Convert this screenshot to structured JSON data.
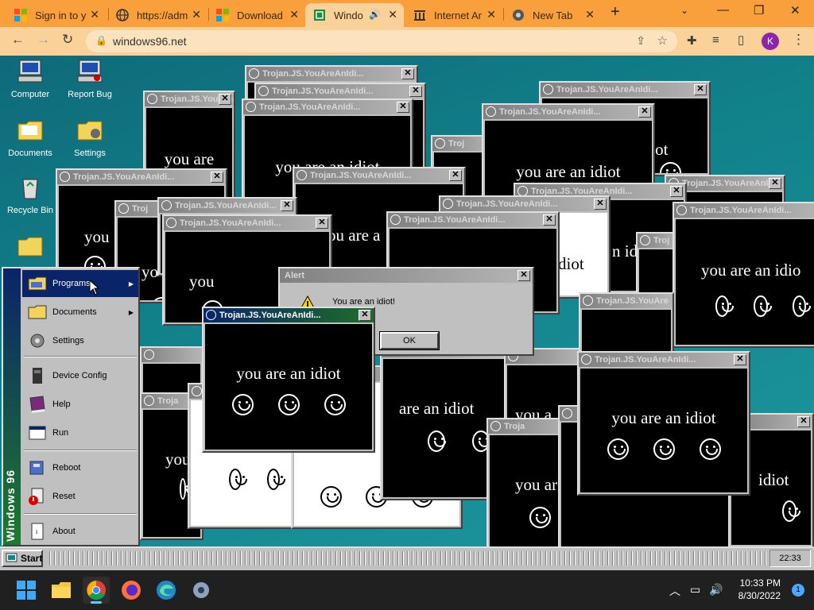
{
  "browser": {
    "tabs": [
      {
        "label": "Sign in to y",
        "icon": "microsoft-icon"
      },
      {
        "label": "https://adm",
        "icon": "globe-icon"
      },
      {
        "label": "Download",
        "icon": "microsoft-icon"
      },
      {
        "label": "Windo",
        "icon": "sheet-icon",
        "active": true,
        "audio": true
      },
      {
        "label": "Internet Ar",
        "icon": "archive-icon"
      },
      {
        "label": "New Tab",
        "icon": "chrome-icon"
      }
    ],
    "url": "windows96.net",
    "profile_initial": "K"
  },
  "desktop": {
    "icons": [
      {
        "label": "Computer"
      },
      {
        "label": "Report Bug"
      },
      {
        "label": "Documents"
      },
      {
        "label": "Settings"
      },
      {
        "label": "Recycle Bin"
      }
    ]
  },
  "popups": {
    "title": "Trojan.JS.YouAreAnIdi...",
    "active_title": "Trojan.JS.YouAreAnIdi...",
    "message": "you are an idiot",
    "frag_1": "you are",
    "frag_2": "you",
    "frag_3": "ou are a",
    "frag_4": "are an idiot",
    "frag_5": "you a",
    "frag_6": "you are an idio",
    "frag_7": "idiot",
    "frag_8": "diot",
    "frag_9": "n id",
    "frag_10": "Troj",
    "frag_11": "Troja",
    "frag_12": "Trojan.JS.YouAre",
    "frag_13": "you are a",
    "frag_14": "you",
    "frag_15": "yo"
  },
  "alert": {
    "title": "Alert",
    "message": "You are an idiot!",
    "ok_label": "OK"
  },
  "start_menu": {
    "brand": "Windows 96",
    "items": [
      {
        "label": "Programs",
        "submenu": true
      },
      {
        "label": "Documents",
        "submenu": true
      },
      {
        "label": "Settings"
      },
      {
        "label": "Device Config"
      },
      {
        "label": "Help"
      },
      {
        "label": "Run"
      },
      {
        "label": "Reboot"
      },
      {
        "label": "Reset"
      },
      {
        "label": "About"
      }
    ]
  },
  "w96_taskbar": {
    "start_label": "Start",
    "clock": "22:33"
  },
  "os_taskbar": {
    "time": "10:33 PM",
    "date": "8/30/2022",
    "notifications": "1"
  }
}
